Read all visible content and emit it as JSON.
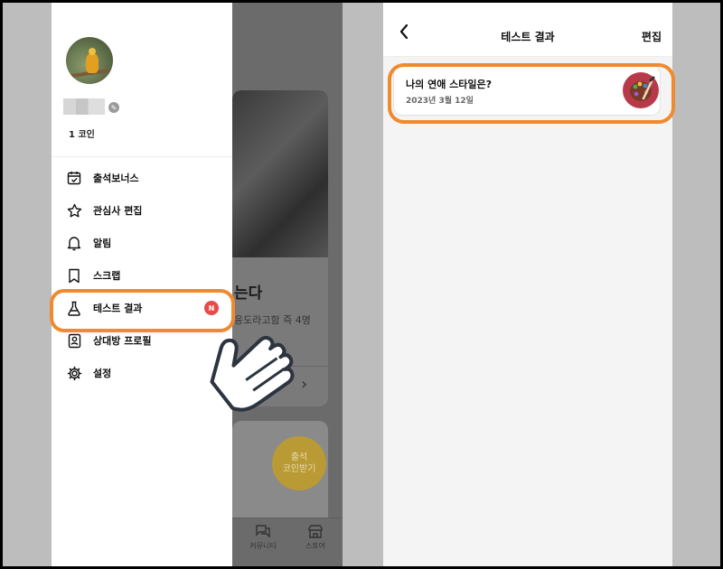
{
  "left_screen": {
    "profile": {
      "coins_label": "1 코인"
    },
    "menu": [
      {
        "label": "출석보너스",
        "icon": "calendar-check-icon"
      },
      {
        "label": "관심사 편집",
        "icon": "star-icon"
      },
      {
        "label": "알림",
        "icon": "bell-icon"
      },
      {
        "label": "스크랩",
        "icon": "bookmark-icon"
      },
      {
        "label": "테스트 결과",
        "icon": "flask-icon",
        "badge": "N"
      },
      {
        "label": "상대방 프로필",
        "icon": "profile-card-icon"
      },
      {
        "label": "설정",
        "icon": "gear-icon"
      }
    ],
    "background": {
      "card_title": "는다",
      "card_subtitle": "응도라고함 즉 4명",
      "coin_button": [
        "출석",
        "코인받기"
      ],
      "nav": [
        {
          "label": "커뮤니티",
          "icon": "chat-icon"
        },
        {
          "label": "스토어",
          "icon": "store-icon"
        }
      ]
    }
  },
  "right_screen": {
    "header": {
      "title": "테스트 결과",
      "edit_label": "편집",
      "back_icon": "chevron-left-icon"
    },
    "results": [
      {
        "title": "나의 연애 스타일은?",
        "date": "2023년 3월 12일",
        "thumbnail_icon": "palette-icon"
      }
    ]
  },
  "colors": {
    "highlight": "#f08a2e",
    "badge": "#e84a4a",
    "coin": "#b99a35"
  }
}
